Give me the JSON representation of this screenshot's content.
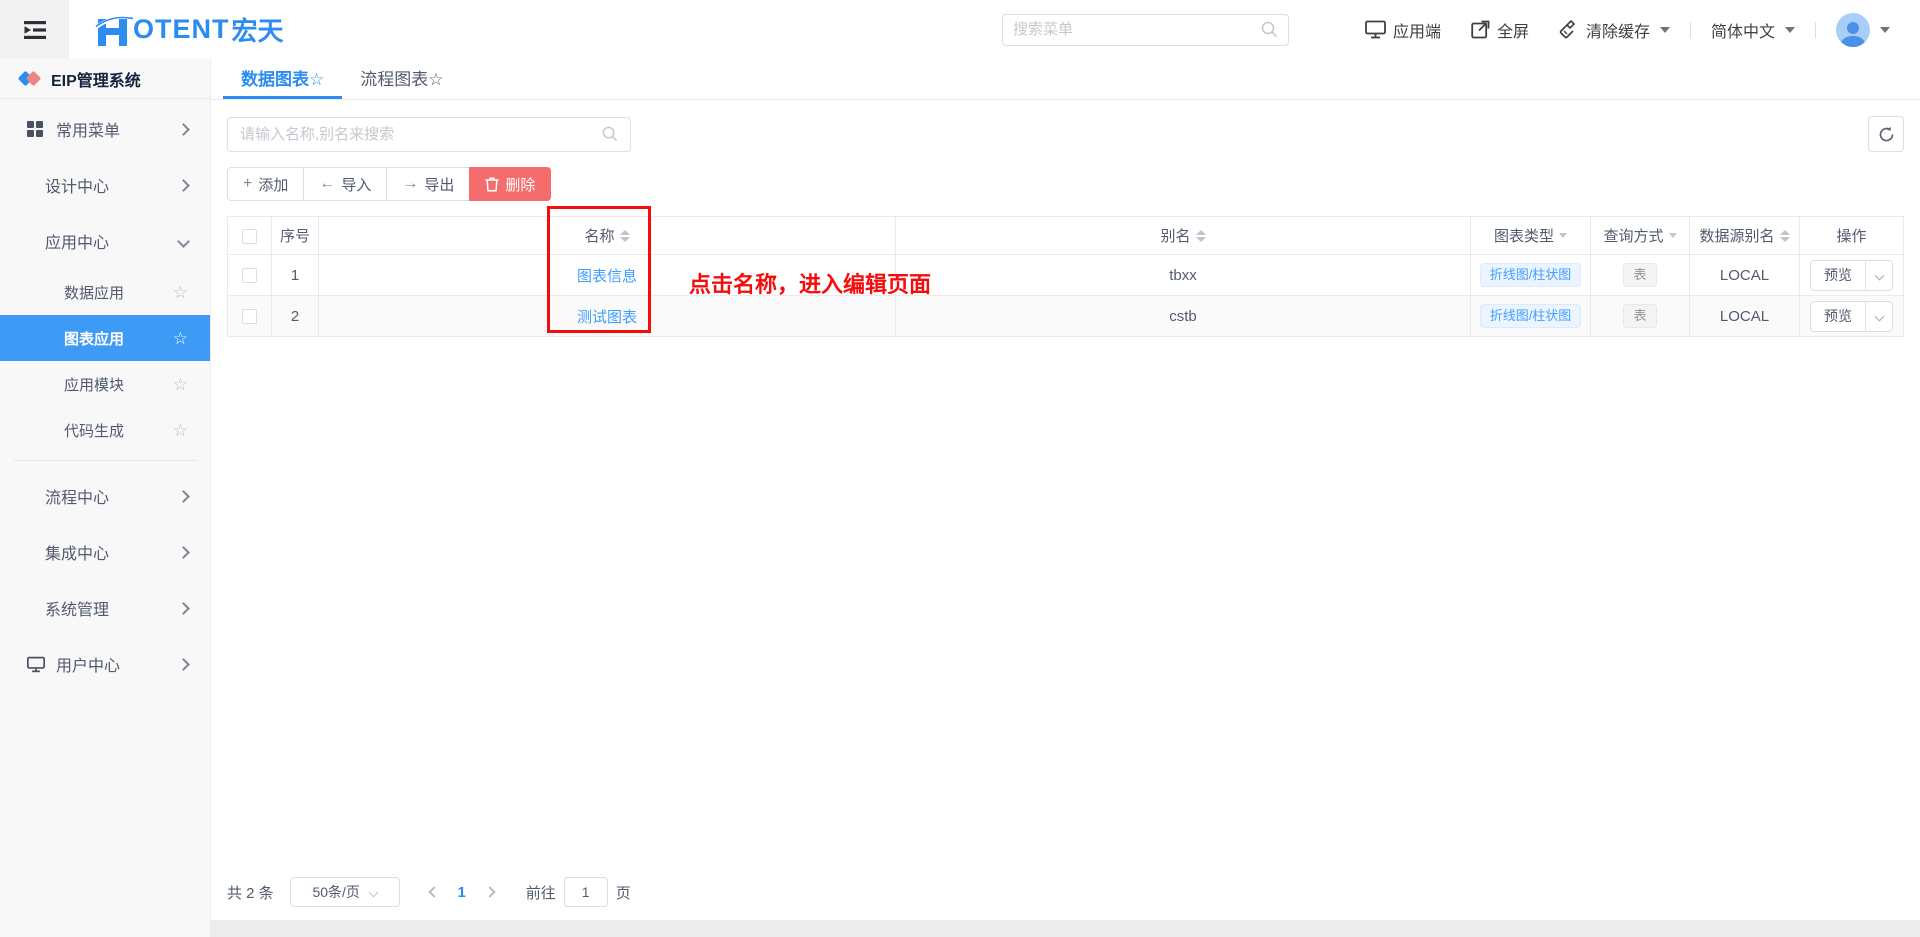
{
  "colors": {
    "primary": "#2d8cf0",
    "selected_menu_bg": "#3d9bf5",
    "link": "#409eff",
    "danger": "#f56c6c",
    "annotation_red": "#f50d0d",
    "tag_blue_bg": "#ecf5ff",
    "tag_blue_text": "#409eff",
    "tag_gray_bg": "#f4f4f5",
    "tag_gray_text": "#909399"
  },
  "header": {
    "logo": {
      "word": "OTENT",
      "suffix": "宏天"
    },
    "search": {
      "placeholder": "搜索菜单"
    },
    "nav": {
      "app_client": "应用端",
      "fullscreen": "全屏",
      "clear_cache": "清除缓存",
      "language": "简体中文"
    }
  },
  "sidebar": {
    "title": "EIP管理系统",
    "star_icon": "☆",
    "items": [
      {
        "label": "常用菜单"
      },
      {
        "label": "设计中心"
      },
      {
        "label": "应用中心"
      },
      {
        "label": "数据应用"
      },
      {
        "label": "图表应用"
      },
      {
        "label": "应用模块"
      },
      {
        "label": "代码生成"
      },
      {
        "label": "流程中心"
      },
      {
        "label": "集成中心"
      },
      {
        "label": "系统管理"
      },
      {
        "label": "用户中心"
      }
    ]
  },
  "main": {
    "tabs": [
      {
        "label": "数据图表☆"
      },
      {
        "label": "流程图表☆"
      }
    ],
    "filter": {
      "placeholder": "请输入名称,别名来搜索"
    },
    "toolbar": {
      "add_icon": "+",
      "add": "添加",
      "import_icon": "←",
      "import": "导入",
      "export_icon": "→",
      "export": "导出",
      "delete": "删除"
    },
    "table": {
      "headers": {
        "seq": "序号",
        "name": "名称",
        "alias": "别名",
        "chart_type": "图表类型",
        "query_mode": "查询方式",
        "datasource": "数据源别名",
        "action": "操作"
      },
      "rows": [
        {
          "seq": "1",
          "name": "图表信息",
          "alias": "tbxx",
          "chart_type": "折线图/柱状图",
          "query_mode": "表",
          "datasource": "LOCAL",
          "action": "预览"
        },
        {
          "seq": "2",
          "name": "测试图表",
          "alias": "cstb",
          "chart_type": "折线图/柱状图",
          "query_mode": "表",
          "datasource": "LOCAL",
          "action": "预览"
        }
      ]
    },
    "annotation": {
      "text": "点击名称，进入编辑页面"
    },
    "pagination": {
      "total": "共 2 条",
      "page_size": "50条/页",
      "current_page": "1",
      "goto_label": "前往",
      "goto_value": "1",
      "page_unit": "页"
    }
  }
}
